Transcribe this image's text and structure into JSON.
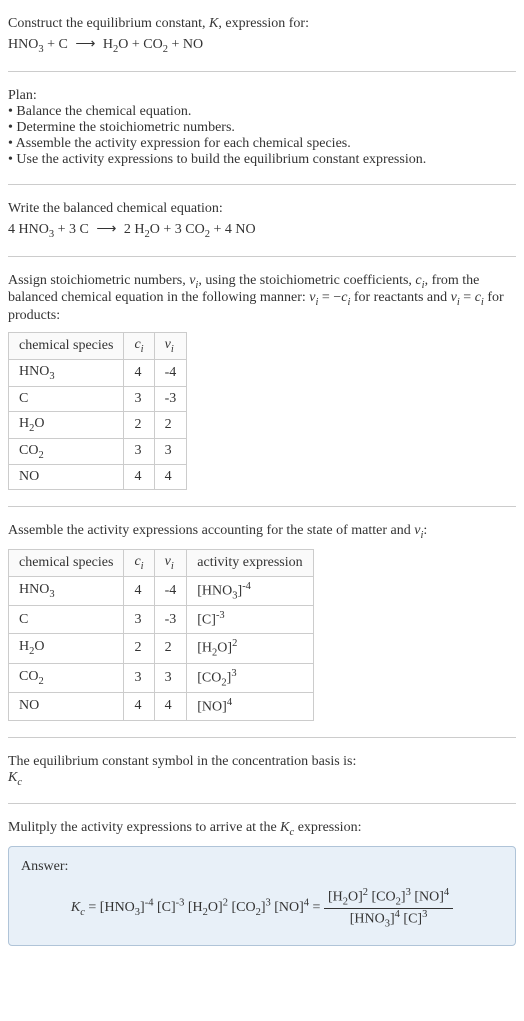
{
  "prompt": {
    "line1": "Construct the equilibrium constant, K, expression for:",
    "eq": "HNO₃ + C ⟶ H₂O + CO₂ + NO"
  },
  "plan": {
    "heading": "Plan:",
    "items": [
      "• Balance the chemical equation.",
      "• Determine the stoichiometric numbers.",
      "• Assemble the activity expression for each chemical species.",
      "• Use the activity expressions to build the equilibrium constant expression."
    ]
  },
  "balanced": {
    "heading": "Write the balanced chemical equation:",
    "eq": "4 HNO₃ + 3 C ⟶ 2 H₂O + 3 CO₂ + 4 NO"
  },
  "stoich": {
    "intro": "Assign stoichiometric numbers, νᵢ, using the stoichiometric coefficients, cᵢ, from the balanced chemical equation in the following manner: νᵢ = -cᵢ for reactants and νᵢ = cᵢ for products:",
    "headers": {
      "species": "chemical species",
      "ci": "cᵢ",
      "vi": "νᵢ"
    },
    "rows": [
      {
        "species": "HNO₃",
        "ci": "4",
        "vi": "-4"
      },
      {
        "species": "C",
        "ci": "3",
        "vi": "-3"
      },
      {
        "species": "H₂O",
        "ci": "2",
        "vi": "2"
      },
      {
        "species": "CO₂",
        "ci": "3",
        "vi": "3"
      },
      {
        "species": "NO",
        "ci": "4",
        "vi": "4"
      }
    ]
  },
  "activity": {
    "intro": "Assemble the activity expressions accounting for the state of matter and νᵢ:",
    "headers": {
      "species": "chemical species",
      "ci": "cᵢ",
      "vi": "νᵢ",
      "expr": "activity expression"
    },
    "rows": [
      {
        "species": "HNO₃",
        "ci": "4",
        "vi": "-4",
        "expr": "[HNO₃]⁻⁴"
      },
      {
        "species": "C",
        "ci": "3",
        "vi": "-3",
        "expr": "[C]⁻³"
      },
      {
        "species": "H₂O",
        "ci": "2",
        "vi": "2",
        "expr": "[H₂O]²"
      },
      {
        "species": "CO₂",
        "ci": "3",
        "vi": "3",
        "expr": "[CO₂]³"
      },
      {
        "species": "NO",
        "ci": "4",
        "vi": "4",
        "expr": "[NO]⁴"
      }
    ]
  },
  "symbol": {
    "line1": "The equilibrium constant symbol in the concentration basis is:",
    "line2": "K_c"
  },
  "multiply": {
    "line": "Mulitply the activity expressions to arrive at the K_c expression:"
  },
  "answer": {
    "label": "Answer:",
    "lhs": "K_c = [HNO₃]⁻⁴ [C]⁻³ [H₂O]² [CO₂]³ [NO]⁴ = ",
    "num": "[H₂O]² [CO₂]³ [NO]⁴",
    "den": "[HNO₃]⁴ [C]³"
  },
  "chart_data": {
    "type": "table",
    "tables": [
      {
        "title": "stoichiometric numbers",
        "columns": [
          "chemical species",
          "cᵢ",
          "νᵢ"
        ],
        "rows": [
          [
            "HNO₃",
            4,
            -4
          ],
          [
            "C",
            3,
            -3
          ],
          [
            "H₂O",
            2,
            2
          ],
          [
            "CO₂",
            3,
            3
          ],
          [
            "NO",
            4,
            4
          ]
        ]
      },
      {
        "title": "activity expressions",
        "columns": [
          "chemical species",
          "cᵢ",
          "νᵢ",
          "activity expression"
        ],
        "rows": [
          [
            "HNO₃",
            4,
            -4,
            "[HNO₃]⁻⁴"
          ],
          [
            "C",
            3,
            -3,
            "[C]⁻³"
          ],
          [
            "H₂O",
            2,
            2,
            "[H₂O]²"
          ],
          [
            "CO₂",
            3,
            3,
            "[CO₂]³"
          ],
          [
            "NO",
            4,
            4,
            "[NO]⁴"
          ]
        ]
      }
    ]
  }
}
